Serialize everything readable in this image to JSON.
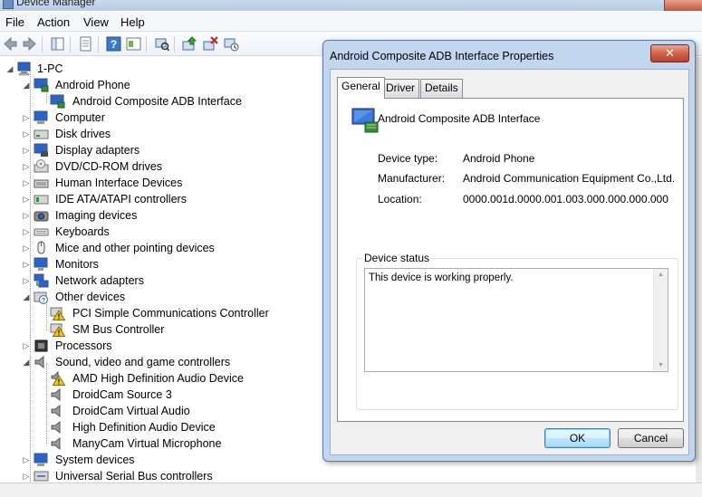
{
  "window": {
    "title": "Device Manager"
  },
  "menu": [
    "File",
    "Action",
    "View",
    "Help"
  ],
  "toolbar": {
    "icons": [
      "back-icon",
      "forward-icon",
      "up-icon",
      "properties-icon",
      "help-icon",
      "view-icon",
      "scan-icon",
      "update-driver-icon",
      "uninstall-icon",
      "disable-icon"
    ]
  },
  "tree": {
    "root": "1-PC",
    "items": [
      {
        "label": "Android Phone",
        "level": 1,
        "expanded": true,
        "icon": "monitor"
      },
      {
        "label": "Android Composite ADB Interface",
        "level": 2,
        "icon": "monitor"
      },
      {
        "label": "Computer",
        "level": 1,
        "icon": "monitor"
      },
      {
        "label": "Disk drives",
        "level": 1,
        "icon": "disk"
      },
      {
        "label": "Display adapters",
        "level": 1,
        "icon": "monitor"
      },
      {
        "label": "DVD/CD-ROM drives",
        "level": 1,
        "icon": "dvd"
      },
      {
        "label": "Human Interface Devices",
        "level": 1,
        "icon": "hid"
      },
      {
        "label": "IDE ATA/ATAPI controllers",
        "level": 1,
        "icon": "ide"
      },
      {
        "label": "Imaging devices",
        "level": 1,
        "icon": "camera"
      },
      {
        "label": "Keyboards",
        "level": 1,
        "icon": "keyboard"
      },
      {
        "label": "Mice and other pointing devices",
        "level": 1,
        "icon": "mouse"
      },
      {
        "label": "Monitors",
        "level": 1,
        "icon": "monitor"
      },
      {
        "label": "Network adapters",
        "level": 1,
        "icon": "network"
      },
      {
        "label": "Other devices",
        "level": 1,
        "expanded": true,
        "icon": "other"
      },
      {
        "label": "PCI Simple Communications Controller",
        "level": 2,
        "icon": "warning"
      },
      {
        "label": "SM Bus Controller",
        "level": 2,
        "icon": "warning"
      },
      {
        "label": "Processors",
        "level": 1,
        "icon": "cpu"
      },
      {
        "label": "Sound, video and game controllers",
        "level": 1,
        "expanded": true,
        "icon": "speaker"
      },
      {
        "label": "AMD High Definition Audio Device",
        "level": 2,
        "icon": "speaker-warning"
      },
      {
        "label": "DroidCam Source 3",
        "level": 2,
        "icon": "speaker"
      },
      {
        "label": "DroidCam Virtual Audio",
        "level": 2,
        "icon": "speaker"
      },
      {
        "label": "High Definition Audio Device",
        "level": 2,
        "icon": "speaker"
      },
      {
        "label": "ManyCam Virtual Microphone",
        "level": 2,
        "icon": "speaker"
      },
      {
        "label": "System devices",
        "level": 1,
        "icon": "monitor"
      },
      {
        "label": "Universal Serial Bus controllers",
        "level": 1,
        "icon": "usb"
      }
    ]
  },
  "dialog": {
    "title": "Android Composite ADB Interface Properties",
    "close_label": "✕",
    "tabs": [
      "General",
      "Driver",
      "Details"
    ],
    "active_tab": "General",
    "device_name": "Android Composite ADB Interface",
    "fields": {
      "device_type_label": "Device type:",
      "device_type": "Android Phone",
      "manufacturer_label": "Manufacturer:",
      "manufacturer": "Android Communication Equipment Co.,Ltd.",
      "location_label": "Location:",
      "location": "0000.001d.0000.001.003.000.000.000.000"
    },
    "status_group_label": "Device status",
    "status_text": "This device is working properly.",
    "ok_label": "OK",
    "cancel_label": "Cancel"
  },
  "colors": {
    "dialog_frame": "#c2d6ee",
    "close_button": "#d0624a",
    "default_button": "#bee6fd",
    "warning": "#f2c318"
  }
}
